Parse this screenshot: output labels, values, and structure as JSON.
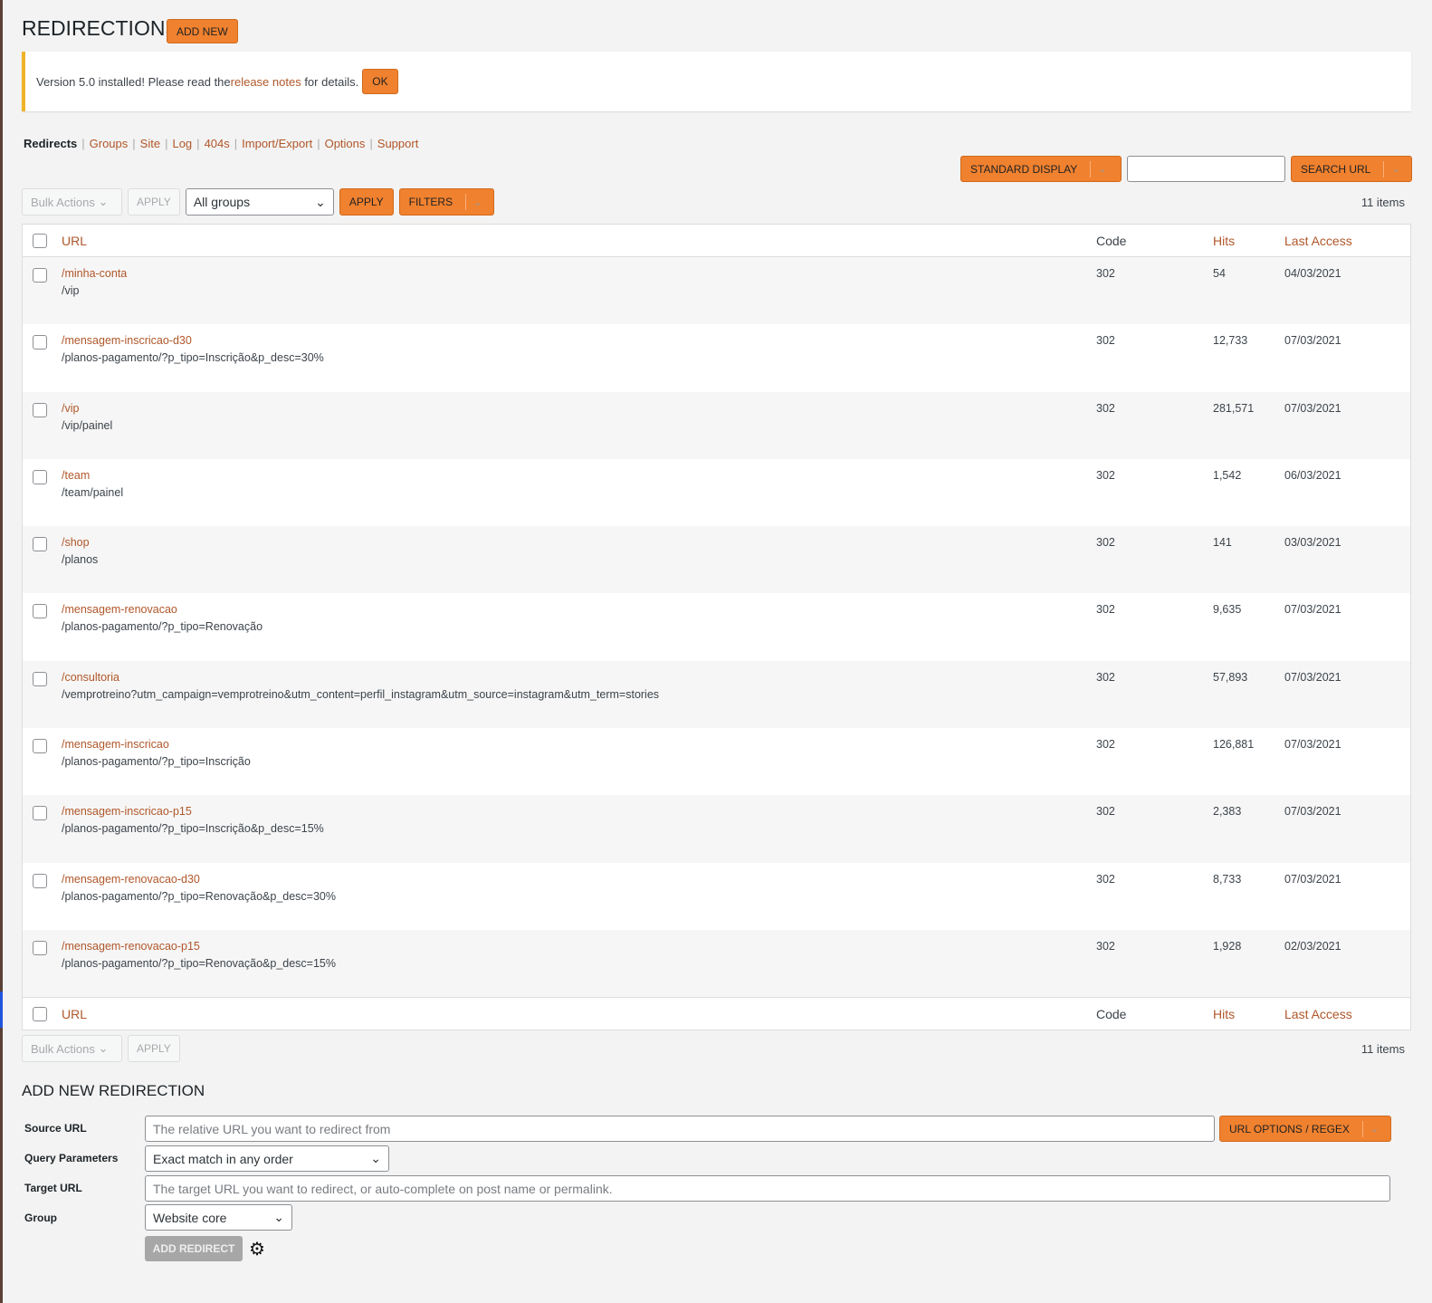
{
  "title": "REDIRECTIONS",
  "add_new": "ADD NEW",
  "notice": {
    "before": "Version 5.0 installed! Please read the ",
    "link": "release notes",
    "after": " for details.",
    "ok": "OK"
  },
  "subnav": [
    {
      "label": "Redirects",
      "active": true
    },
    {
      "label": "Groups"
    },
    {
      "label": "Site"
    },
    {
      "label": "Log"
    },
    {
      "label": "404s"
    },
    {
      "label": "Import/Export"
    },
    {
      "label": "Options"
    },
    {
      "label": "Support"
    }
  ],
  "toolbar": {
    "display": "STANDARD DISPLAY",
    "search_value": "",
    "search_btn": "SEARCH URL",
    "bulk": "Bulk Actions",
    "apply": "APPLY",
    "group_select": "All groups",
    "apply2": "APPLY",
    "filters": "FILTERS",
    "count": "11 items"
  },
  "columns": {
    "url": "URL",
    "code": "Code",
    "hits": "Hits",
    "last": "Last Access"
  },
  "rows": [
    {
      "src": "/minha-conta",
      "tgt": "/vip",
      "code": "302",
      "hits": "54",
      "last": "04/03/2021"
    },
    {
      "src": "/mensagem-inscricao-d30",
      "tgt": "/planos-pagamento/?p_tipo=Inscrição&p_desc=30%",
      "code": "302",
      "hits": "12,733",
      "last": "07/03/2021"
    },
    {
      "src": "/vip",
      "tgt": "/vip/painel",
      "code": "302",
      "hits": "281,571",
      "last": "07/03/2021"
    },
    {
      "src": "/team",
      "tgt": "/team/painel",
      "code": "302",
      "hits": "1,542",
      "last": "06/03/2021"
    },
    {
      "src": "/shop",
      "tgt": "/planos",
      "code": "302",
      "hits": "141",
      "last": "03/03/2021"
    },
    {
      "src": "/mensagem-renovacao",
      "tgt": "/planos-pagamento/?p_tipo=Renovação",
      "code": "302",
      "hits": "9,635",
      "last": "07/03/2021"
    },
    {
      "src": "/consultoria",
      "tgt": "/vemprotreino?utm_campaign=vemprotreino&utm_content=perfil_instagram&utm_source=instagram&utm_term=stories",
      "code": "302",
      "hits": "57,893",
      "last": "07/03/2021"
    },
    {
      "src": "/mensagem-inscricao",
      "tgt": "/planos-pagamento/?p_tipo=Inscrição",
      "code": "302",
      "hits": "126,881",
      "last": "07/03/2021"
    },
    {
      "src": "/mensagem-inscricao-p15",
      "tgt": "/planos-pagamento/?p_tipo=Inscrição&p_desc=15%",
      "code": "302",
      "hits": "2,383",
      "last": "07/03/2021"
    },
    {
      "src": "/mensagem-renovacao-d30",
      "tgt": "/planos-pagamento/?p_tipo=Renovação&p_desc=30%",
      "code": "302",
      "hits": "8,733",
      "last": "07/03/2021"
    },
    {
      "src": "/mensagem-renovacao-p15",
      "tgt": "/planos-pagamento/?p_tipo=Renovação&p_desc=15%",
      "code": "302",
      "hits": "1,928",
      "last": "02/03/2021"
    }
  ],
  "form": {
    "heading": "ADD NEW REDIRECTION",
    "source_label": "Source URL",
    "source_placeholder": "The relative URL you want to redirect from",
    "url_options": "URL OPTIONS / REGEX",
    "query_label": "Query Parameters",
    "query_value": "Exact match in any order",
    "target_label": "Target URL",
    "target_placeholder": "The target URL you want to redirect, or auto-complete on post name or permalink.",
    "group_label": "Group",
    "group_value": "Website core",
    "submit": "ADD REDIRECT"
  }
}
